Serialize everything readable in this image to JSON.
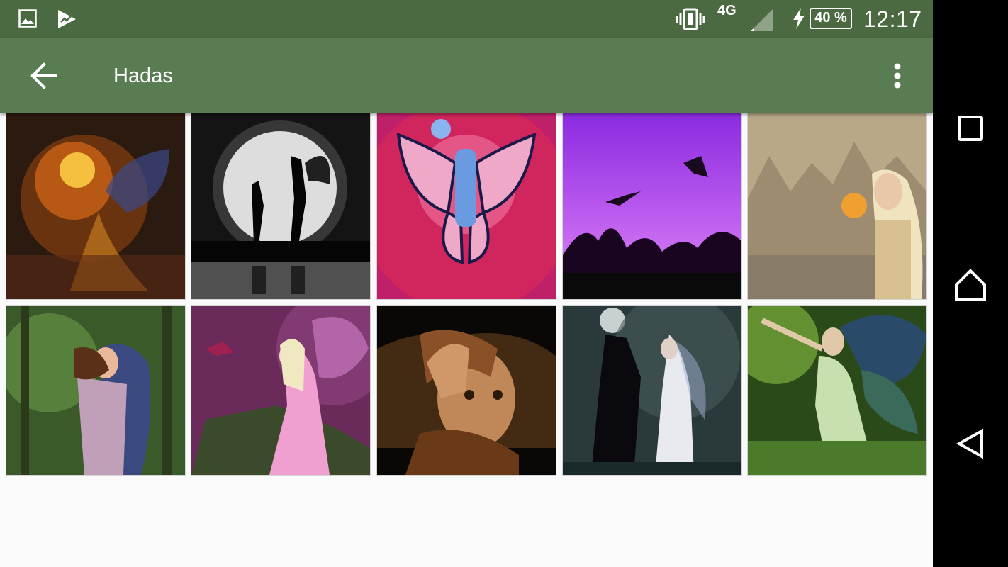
{
  "status_bar": {
    "network": "4G",
    "battery": "40 %",
    "time": "12:17",
    "icons": [
      "gallery-icon",
      "play-store-icon",
      "vibrate-icon",
      "signal-icon",
      "charging-icon",
      "battery-icon"
    ]
  },
  "toolbar": {
    "title": "Hadas",
    "back_icon": "arrow-back-icon",
    "overflow_icon": "more-vert-icon",
    "background": "#5a7c52"
  },
  "grid": {
    "rows": 2,
    "columns": 5,
    "items": [
      {
        "subject": "fire-fairy-artwork"
      },
      {
        "subject": "moon-silhouette-fairies"
      },
      {
        "subject": "cartoon-butterfly-fairy"
      },
      {
        "subject": "purple-sky-flying-fairies"
      },
      {
        "subject": "blonde-fairy-with-light"
      },
      {
        "subject": "forest-warrior-fairies"
      },
      {
        "subject": "pink-fairy-with-hummingbird"
      },
      {
        "subject": "elf-girl-face"
      },
      {
        "subject": "fairy-with-black-horse"
      },
      {
        "subject": "green-butterfly-wing-fairy"
      }
    ]
  },
  "nav_bar": {
    "icons": [
      "recents-icon",
      "home-icon",
      "back-triangle-icon"
    ]
  },
  "colors": {
    "status_bar": "#4b6a42",
    "toolbar": "#5a7c52",
    "background": "#fafafa",
    "nav_bar": "#000000"
  }
}
